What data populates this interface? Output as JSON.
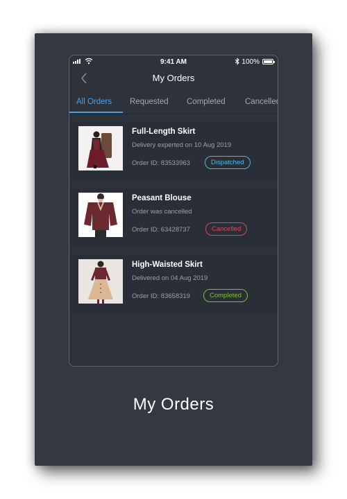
{
  "status_bar": {
    "time": "9:41 AM",
    "battery": "100%"
  },
  "header": {
    "title": "My Orders",
    "back_icon": "chevron-left-icon"
  },
  "tabs": [
    {
      "label": "All Orders",
      "active": true
    },
    {
      "label": "Requested",
      "active": false
    },
    {
      "label": "Completed",
      "active": false
    },
    {
      "label": "Cancelled",
      "active": false
    }
  ],
  "orders": [
    {
      "name": "Full-Length Skirt",
      "status": "Delivery experted on 10 Aug 2019",
      "order_id": "Order ID: 83533963",
      "badge": "Dispatched"
    },
    {
      "name": "Peasant Blouse",
      "status": "Order was cancelled",
      "order_id": "Order ID: 63428737",
      "badge": "Cancelled"
    },
    {
      "name": "High-Waisted Skirt",
      "status": "Delivered on 04 Aug 2019",
      "order_id": "Order ID: 83658319",
      "badge": "Completed"
    }
  ],
  "badge_colors": {
    "Dispatched": "#4fb9e8",
    "Cancelled": "#e0484f",
    "Completed": "#7cc23a"
  },
  "tab_accent": "#4aa3ea",
  "caption": "My Orders"
}
